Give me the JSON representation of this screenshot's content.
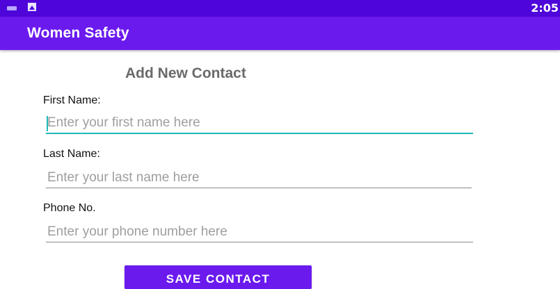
{
  "status_bar": {
    "time": "2:05",
    "icons": [
      "keyboard-icon",
      "photo-icon"
    ],
    "color": "#4e05d9"
  },
  "app_bar": {
    "title": "Women Safety",
    "color": "#6b1aee"
  },
  "form": {
    "heading": "Add New Contact",
    "first_name": {
      "label": "First Name:",
      "placeholder": "Enter your first name here",
      "value": "",
      "focused": true
    },
    "last_name": {
      "label": "Last Name:",
      "placeholder": "Enter your last name here",
      "value": ""
    },
    "phone": {
      "label": "Phone No.",
      "placeholder": "Enter your phone number here",
      "value": ""
    },
    "save_label": "SAVE CONTACT"
  },
  "colors": {
    "accent": "#1fb8b8",
    "primary": "#6b1aee"
  }
}
